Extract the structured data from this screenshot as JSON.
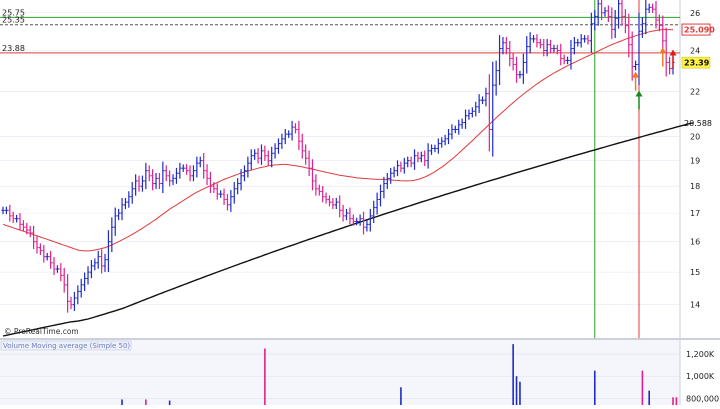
{
  "watermark": "© ProRealTime.com",
  "volume_panel_label": "Volume Moving average (Simple 50)",
  "colors": {
    "up": "#1f2bc8",
    "down": "#e0208c",
    "ma_short": "#e03a3a",
    "ma_long": "#111111",
    "hline_green": "#2aa02a",
    "hline_red": "#e03a3a",
    "hline_dash": "#555555",
    "vline_green": "#2aa02a",
    "vline_red": "#e03a3a",
    "arrow_green": "#1a8a1a",
    "arrow_orange": "#f07820",
    "arrow_red": "#e01818",
    "grid": "#e2e6f0",
    "panel_bg": "#f4f6fb"
  },
  "chart_data": [
    {
      "type": "ohlc",
      "y_scale": "log",
      "ylim": [
        13.1,
        26.6
      ],
      "ytick_labels": [
        "14",
        "15",
        "16",
        "17",
        "18",
        "19",
        "20",
        "22",
        "24",
        "26"
      ],
      "y_ticks": [
        14,
        15,
        16,
        17,
        18,
        19,
        20,
        22,
        24,
        26
      ],
      "price_labels": [
        {
          "text": "25.75",
          "value": 25.75
        },
        {
          "text": "25.35",
          "value": 25.35
        },
        {
          "text": "23.88",
          "value": 23.88
        }
      ],
      "axis_markers": [
        {
          "text": "25.090",
          "value": 25.09,
          "style": "outline-red"
        },
        {
          "text": "23.39",
          "value": 23.39,
          "style": "fill-yellow"
        },
        {
          "text": "20.588",
          "value": 20.588,
          "style": "plain"
        }
      ],
      "hlines": [
        {
          "value": 25.75,
          "color": "green"
        },
        {
          "value": 25.35,
          "color": "dash"
        },
        {
          "value": 23.88,
          "color": "red"
        }
      ],
      "vlines": [
        {
          "bar": 174,
          "color": "green"
        },
        {
          "bar": 187,
          "color": "red"
        }
      ],
      "arrows": [
        {
          "bar": 187,
          "value": 22.0,
          "color": "green",
          "dir": "up"
        },
        {
          "bar": 186,
          "value": 22.9,
          "color": "orange",
          "dir": "up"
        },
        {
          "bar": 194,
          "value": 24.1,
          "color": "orange",
          "dir": "up"
        },
        {
          "bar": 197,
          "value": 24.0,
          "color": "red",
          "dir": "up"
        }
      ],
      "close": [
        17.1,
        17.1,
        16.9,
        16.8,
        16.8,
        16.6,
        16.5,
        16.4,
        16.3,
        16.0,
        15.8,
        15.7,
        15.5,
        15.5,
        15.3,
        15.1,
        15.1,
        14.9,
        14.6,
        14.1,
        14.0,
        14.2,
        14.4,
        14.6,
        14.8,
        15.0,
        15.2,
        15.3,
        15.5,
        15.2,
        15.4,
        16.0,
        16.5,
        16.9,
        17.0,
        17.3,
        17.4,
        17.6,
        17.9,
        18.2,
        18.0,
        18.2,
        18.6,
        18.4,
        18.1,
        18.3,
        18.1,
        18.6,
        18.4,
        18.2,
        18.3,
        18.5,
        18.7,
        18.7,
        18.6,
        18.4,
        18.6,
        18.9,
        19.0,
        18.6,
        18.3,
        18.0,
        17.9,
        17.7,
        17.7,
        17.5,
        17.3,
        17.6,
        17.9,
        18.1,
        18.4,
        18.6,
        18.9,
        19.2,
        19.3,
        19.1,
        19.4,
        19.2,
        19.0,
        19.3,
        19.5,
        19.7,
        19.9,
        20.1,
        20.1,
        20.4,
        20.3,
        19.8,
        19.4,
        19.1,
        18.7,
        18.2,
        17.9,
        17.8,
        17.6,
        17.5,
        17.4,
        17.3,
        17.4,
        17.1,
        16.9,
        17.0,
        16.8,
        16.7,
        16.7,
        16.8,
        16.5,
        16.6,
        16.9,
        17.2,
        17.5,
        17.8,
        18.1,
        18.3,
        18.5,
        18.6,
        18.8,
        18.7,
        18.9,
        19.0,
        18.9,
        19.2,
        19.1,
        19.2,
        19.0,
        19.4,
        19.5,
        19.5,
        19.7,
        19.8,
        19.9,
        20.1,
        20.3,
        20.3,
        20.5,
        20.6,
        20.9,
        21.0,
        21.1,
        21.3,
        21.6,
        21.6,
        21.9,
        20.3,
        22.3,
        23.0,
        24.1,
        24.4,
        24.1,
        23.6,
        23.3,
        22.8,
        22.8,
        23.4,
        24.2,
        24.6,
        24.6,
        24.4,
        24.3,
        24.0,
        24.3,
        24.1,
        24.1,
        24.0,
        23.6,
        23.5,
        23.5,
        24.1,
        24.4,
        24.4,
        24.6,
        24.6,
        24.5,
        25.4,
        25.8,
        26.5,
        26.0,
        26.1,
        25.8,
        25.1,
        25.7,
        26.5,
        25.8,
        25.3,
        24.3,
        23.2,
        23.3,
        25.0,
        25.4,
        26.2,
        26.3,
        26.2,
        25.6,
        25.3,
        24.5,
        23.4,
        23.1,
        23.4
      ],
      "ma50": [
        16.6,
        16.56,
        16.52,
        16.48,
        16.44,
        16.4,
        16.36,
        16.32,
        16.28,
        16.24,
        16.2,
        16.16,
        16.12,
        16.08,
        16.04,
        16.0,
        15.96,
        15.92,
        15.88,
        15.84,
        15.8,
        15.76,
        15.72,
        15.7,
        15.69,
        15.69,
        15.7,
        15.72,
        15.74,
        15.77,
        15.8,
        15.84,
        15.89,
        15.95,
        16.0,
        16.06,
        16.12,
        16.18,
        16.25,
        16.32,
        16.39,
        16.46,
        16.54,
        16.62,
        16.7,
        16.78,
        16.87,
        16.96,
        17.05,
        17.14,
        17.22,
        17.3,
        17.38,
        17.46,
        17.54,
        17.62,
        17.7,
        17.77,
        17.84,
        17.9,
        17.96,
        18.02,
        18.08,
        18.14,
        18.2,
        18.26,
        18.31,
        18.36,
        18.41,
        18.46,
        18.51,
        18.55,
        18.59,
        18.62,
        18.66,
        18.7,
        18.73,
        18.76,
        18.79,
        18.81,
        18.83,
        18.84,
        18.85,
        18.85,
        18.84,
        18.82,
        18.8,
        18.78,
        18.75,
        18.72,
        18.69,
        18.66,
        18.63,
        18.6,
        18.57,
        18.54,
        18.51,
        18.48,
        18.45,
        18.42,
        18.4,
        18.38,
        18.36,
        18.34,
        18.32,
        18.31,
        18.3,
        18.29,
        18.28,
        18.27,
        18.26,
        18.26,
        18.26,
        18.25,
        18.24,
        18.23,
        18.22,
        18.21,
        18.2,
        18.2,
        18.21,
        18.23,
        18.26,
        18.3,
        18.35,
        18.41,
        18.48,
        18.56,
        18.65,
        18.74,
        18.84,
        18.95,
        19.06,
        19.18,
        19.3,
        19.43,
        19.56,
        19.69,
        19.82,
        19.96,
        20.1,
        20.24,
        20.38,
        20.52,
        20.66,
        20.8,
        20.94,
        21.08,
        21.22,
        21.36,
        21.49,
        21.62,
        21.75,
        21.88,
        22.0,
        22.12,
        22.24,
        22.36,
        22.47,
        22.58,
        22.68,
        22.78,
        22.88,
        22.97,
        23.06,
        23.15,
        23.24,
        23.32,
        23.4,
        23.48,
        23.56,
        23.64,
        23.72,
        23.8,
        23.88,
        23.97,
        24.06,
        24.14,
        24.22,
        24.3,
        24.37,
        24.44,
        24.51,
        24.58,
        24.64,
        24.7,
        24.76,
        24.82,
        24.87,
        24.92,
        24.97,
        25.01,
        25.04,
        25.07,
        25.09,
        25.09,
        25.09,
        25.08
      ],
      "ma200": [
        13.1,
        13.12,
        13.14,
        13.16,
        13.18,
        13.2,
        13.22,
        13.24,
        13.26,
        13.28,
        13.3,
        13.32,
        13.34,
        13.36,
        13.38,
        13.4,
        13.42,
        13.44,
        13.46,
        13.48,
        13.5,
        13.51,
        13.52,
        13.54,
        13.56,
        13.58,
        13.61,
        13.64,
        13.67,
        13.7,
        13.73,
        13.76,
        13.79,
        13.82,
        13.85,
        13.88,
        13.92,
        13.96,
        14.0,
        14.04,
        14.08,
        14.12,
        14.16,
        14.2,
        14.24,
        14.28,
        14.32,
        14.36,
        14.4,
        14.44,
        14.48,
        14.52,
        14.56,
        14.6,
        14.64,
        14.68,
        14.72,
        14.76,
        14.8,
        14.84,
        14.88,
        14.92,
        14.96,
        15.0,
        15.04,
        15.08,
        15.12,
        15.16,
        15.2,
        15.24,
        15.28,
        15.32,
        15.36,
        15.4,
        15.44,
        15.48,
        15.52,
        15.56,
        15.6,
        15.64,
        15.68,
        15.72,
        15.76,
        15.8,
        15.84,
        15.88,
        15.92,
        15.96,
        16.0,
        16.04,
        16.08,
        16.12,
        16.16,
        16.2,
        16.24,
        16.28,
        16.32,
        16.36,
        16.4,
        16.44,
        16.48,
        16.52,
        16.56,
        16.6,
        16.64,
        16.68,
        16.72,
        16.76,
        16.8,
        16.84,
        16.88,
        16.92,
        16.96,
        17.0,
        17.04,
        17.08,
        17.12,
        17.16,
        17.2,
        17.24,
        17.28,
        17.32,
        17.36,
        17.4,
        17.44,
        17.48,
        17.52,
        17.56,
        17.6,
        17.64,
        17.68,
        17.72,
        17.76,
        17.8,
        17.84,
        17.88,
        17.92,
        17.96,
        18.0,
        18.04,
        18.08,
        18.12,
        18.16,
        18.2,
        18.24,
        18.28,
        18.32,
        18.36,
        18.4,
        18.44,
        18.48,
        18.52,
        18.56,
        18.6,
        18.64,
        18.68,
        18.72,
        18.76,
        18.8,
        18.84,
        18.88,
        18.92,
        18.96,
        19.0,
        19.04,
        19.08,
        19.12,
        19.16,
        19.2,
        19.24,
        19.28,
        19.32,
        19.36,
        19.4,
        19.44,
        19.48,
        19.52,
        19.56,
        19.6,
        19.64,
        19.68,
        19.72,
        19.76,
        19.8,
        19.84,
        19.88,
        19.92,
        19.96,
        20.0,
        20.04,
        20.08,
        20.12,
        20.16,
        20.2,
        20.24,
        20.28,
        20.32,
        20.36,
        20.4,
        20.44,
        20.48,
        20.52,
        20.56,
        20.59
      ]
    },
    {
      "type": "bar",
      "title": "Volume Moving average (Simple 50)",
      "ylim": [
        740000,
        1300000
      ],
      "ytick_labels": [
        "1,200K",
        "1,000K",
        "800,000"
      ],
      "y_ticks": [
        1200000,
        1000000,
        800000
      ],
      "axis_markers": [
        {
          "text": "1,000K",
          "value": 1000000,
          "style": "plain"
        }
      ],
      "spikes": [
        {
          "bar": 150,
          "value": 1290000,
          "color": "up"
        },
        {
          "bar": 151,
          "value": 1000000,
          "color": "up"
        },
        {
          "bar": 152,
          "value": 950000,
          "color": "up"
        },
        {
          "bar": 117,
          "value": 900000,
          "color": "up"
        },
        {
          "bar": 77,
          "value": 1250000,
          "color": "down"
        },
        {
          "bar": 174,
          "value": 1050000,
          "color": "up"
        },
        {
          "bar": 188,
          "value": 1050000,
          "color": "down"
        },
        {
          "bar": 190,
          "value": 870000,
          "color": "up"
        },
        {
          "bar": 197,
          "value": 810000,
          "color": "down"
        },
        {
          "bar": 198,
          "value": 810000,
          "color": "down"
        },
        {
          "bar": 35,
          "value": 790000,
          "color": "up"
        },
        {
          "bar": 42,
          "value": 790000,
          "color": "down"
        },
        {
          "bar": 49,
          "value": 780000,
          "color": "up"
        }
      ]
    }
  ]
}
